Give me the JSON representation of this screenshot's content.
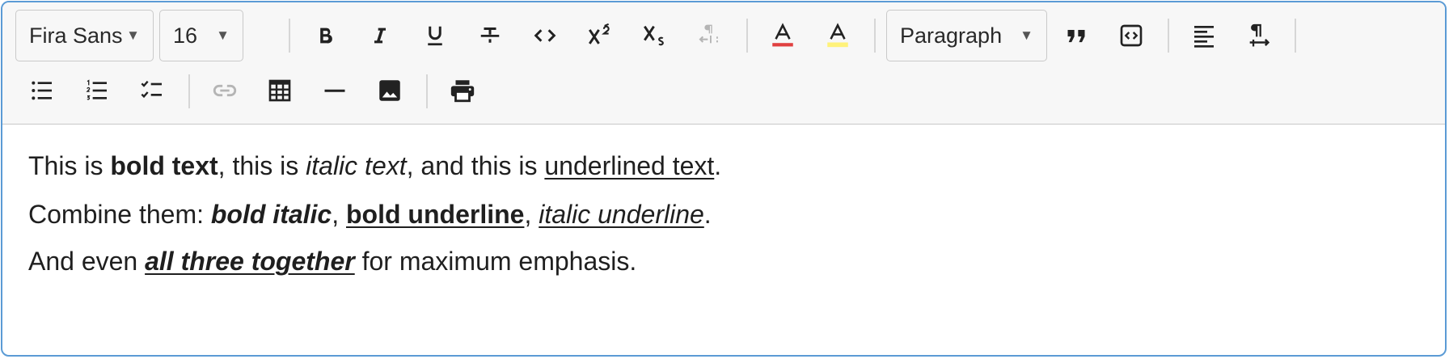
{
  "toolbar": {
    "font_family": {
      "value": "Fira Sans",
      "caret": "▼"
    },
    "font_size": {
      "value": "16",
      "caret": "▼"
    },
    "block_format": {
      "value": "Paragraph",
      "caret": "▼"
    },
    "icons": {
      "bold": "bold-icon",
      "italic": "italic-icon",
      "underline": "underline-icon",
      "strikethrough": "strikethrough-icon",
      "code": "code-icon",
      "superscript": "superscript-icon",
      "subscript": "subscript-icon",
      "text_direction": "text-direction-rtl-icon",
      "text_color": "text-color-icon",
      "highlight": "highlight-color-icon",
      "blockquote": "blockquote-icon",
      "code_block": "code-block-icon",
      "align": "align-left-icon",
      "direction": "paragraph-ltr-icon",
      "bullet_list": "bullet-list-icon",
      "ordered_list": "numbered-list-icon",
      "task_list": "task-list-icon",
      "link": "link-icon",
      "table": "table-icon",
      "horizontal_rule": "horizontal-rule-icon",
      "image": "image-icon",
      "print": "print-icon"
    },
    "colors": {
      "text_color_bar": "#e04040",
      "highlight_bar": "#fff27a",
      "disabled": "#b5b5b5"
    }
  },
  "content": {
    "line1": {
      "t1": "This is ",
      "bold": "bold text",
      "t2": ", this is ",
      "italic": "italic text",
      "t3": ", and this is ",
      "underline": "underlined text",
      "t4": "."
    },
    "line2": {
      "t1": "Combine them: ",
      "bold_italic": "bold italic",
      "t2": ", ",
      "bold_underline": "bold underline",
      "t3": ", ",
      "italic_underline": "italic underline",
      "t4": "."
    },
    "line3": {
      "t1": "And even ",
      "all_three": "all three together",
      "t2": " for maximum emphasis."
    }
  }
}
